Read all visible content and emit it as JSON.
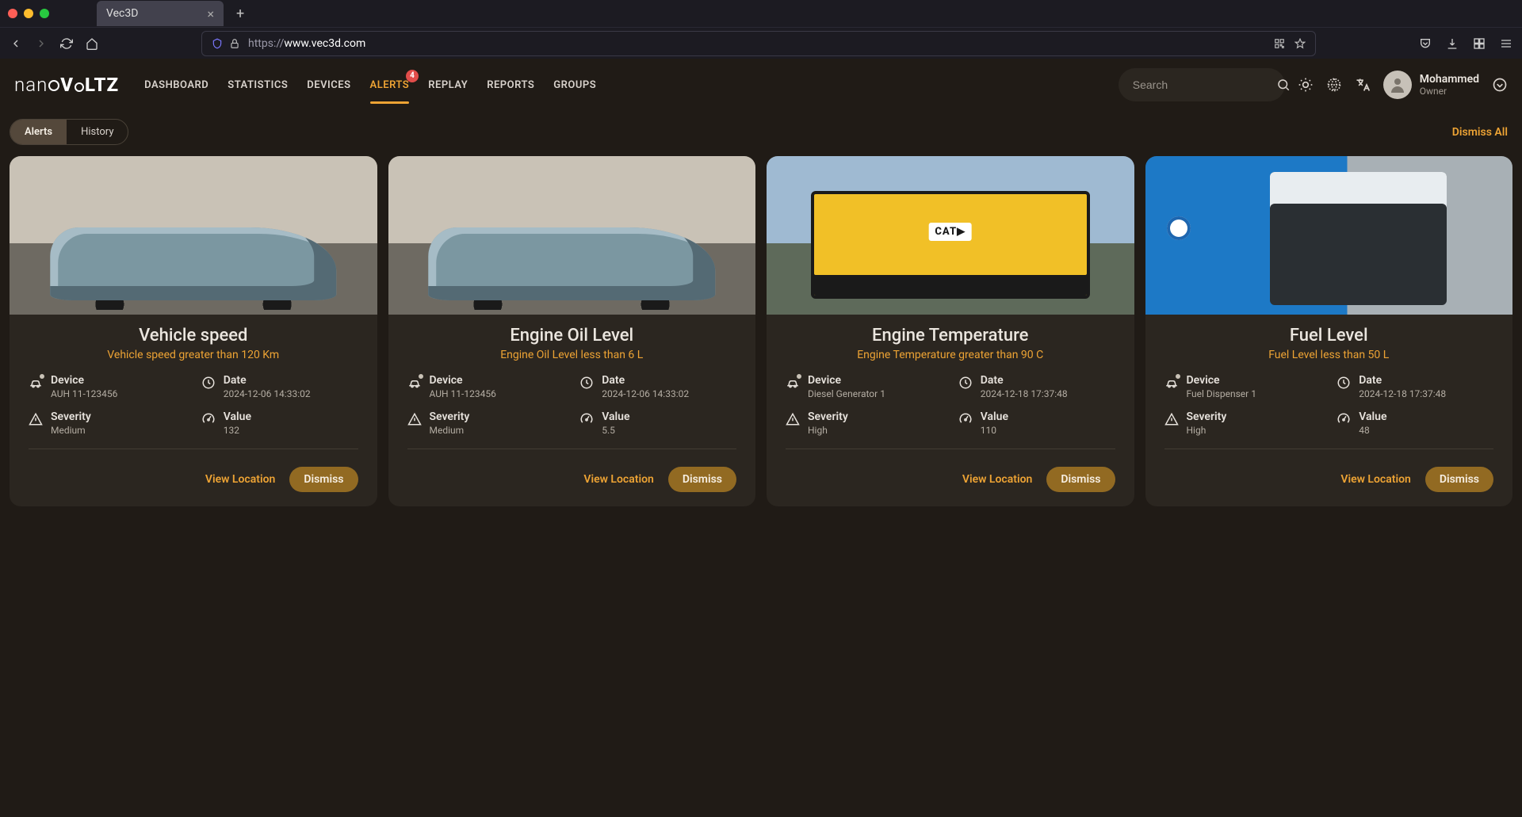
{
  "browser": {
    "tab_title": "Vec3D",
    "url_prefix": "https://",
    "url_domain": "www.vec3d.com",
    "url_path": ""
  },
  "brand": {
    "thin": "nan",
    "bold": "VOLTZ"
  },
  "nav": {
    "items": [
      {
        "label": "DASHBOARD",
        "active": false,
        "badge": null
      },
      {
        "label": "STATISTICS",
        "active": false,
        "badge": null
      },
      {
        "label": "DEVICES",
        "active": false,
        "badge": null
      },
      {
        "label": "ALERTS",
        "active": true,
        "badge": "4"
      },
      {
        "label": "REPLAY",
        "active": false,
        "badge": null
      },
      {
        "label": "REPORTS",
        "active": false,
        "badge": null
      },
      {
        "label": "GROUPS",
        "active": false,
        "badge": null
      }
    ]
  },
  "search": {
    "placeholder": "Search"
  },
  "user": {
    "name": "Mohammed",
    "role": "Owner"
  },
  "tabs": {
    "alerts": "Alerts",
    "history": "History"
  },
  "dismiss_all": "Dismiss All",
  "labels": {
    "device": "Device",
    "date": "Date",
    "severity": "Severity",
    "value": "Value",
    "view_location": "View Location",
    "dismiss": "Dismiss"
  },
  "alerts": [
    {
      "img": "vehicle",
      "title": "Vehicle speed",
      "sub": "Vehicle speed greater than 120 Km",
      "device": "AUH 11-123456",
      "date": "2024-12-06 14:33:02",
      "severity": "Medium",
      "value": "132"
    },
    {
      "img": "vehicle",
      "title": "Engine Oil Level",
      "sub": "Engine Oil Level less than 6 L",
      "device": "AUH 11-123456",
      "date": "2024-12-06 14:33:02",
      "severity": "Medium",
      "value": "5.5"
    },
    {
      "img": "generator",
      "title": "Engine Temperature",
      "sub": "Engine Temperature greater than 90 C",
      "device": "Diesel Generator 1",
      "date": "2024-12-18 17:37:48",
      "severity": "High",
      "value": "110"
    },
    {
      "img": "fuel",
      "title": "Fuel Level",
      "sub": "Fuel Level less than 50 L",
      "device": "Fuel Dispenser 1",
      "date": "2024-12-18 17:37:48",
      "severity": "High",
      "value": "48"
    }
  ]
}
